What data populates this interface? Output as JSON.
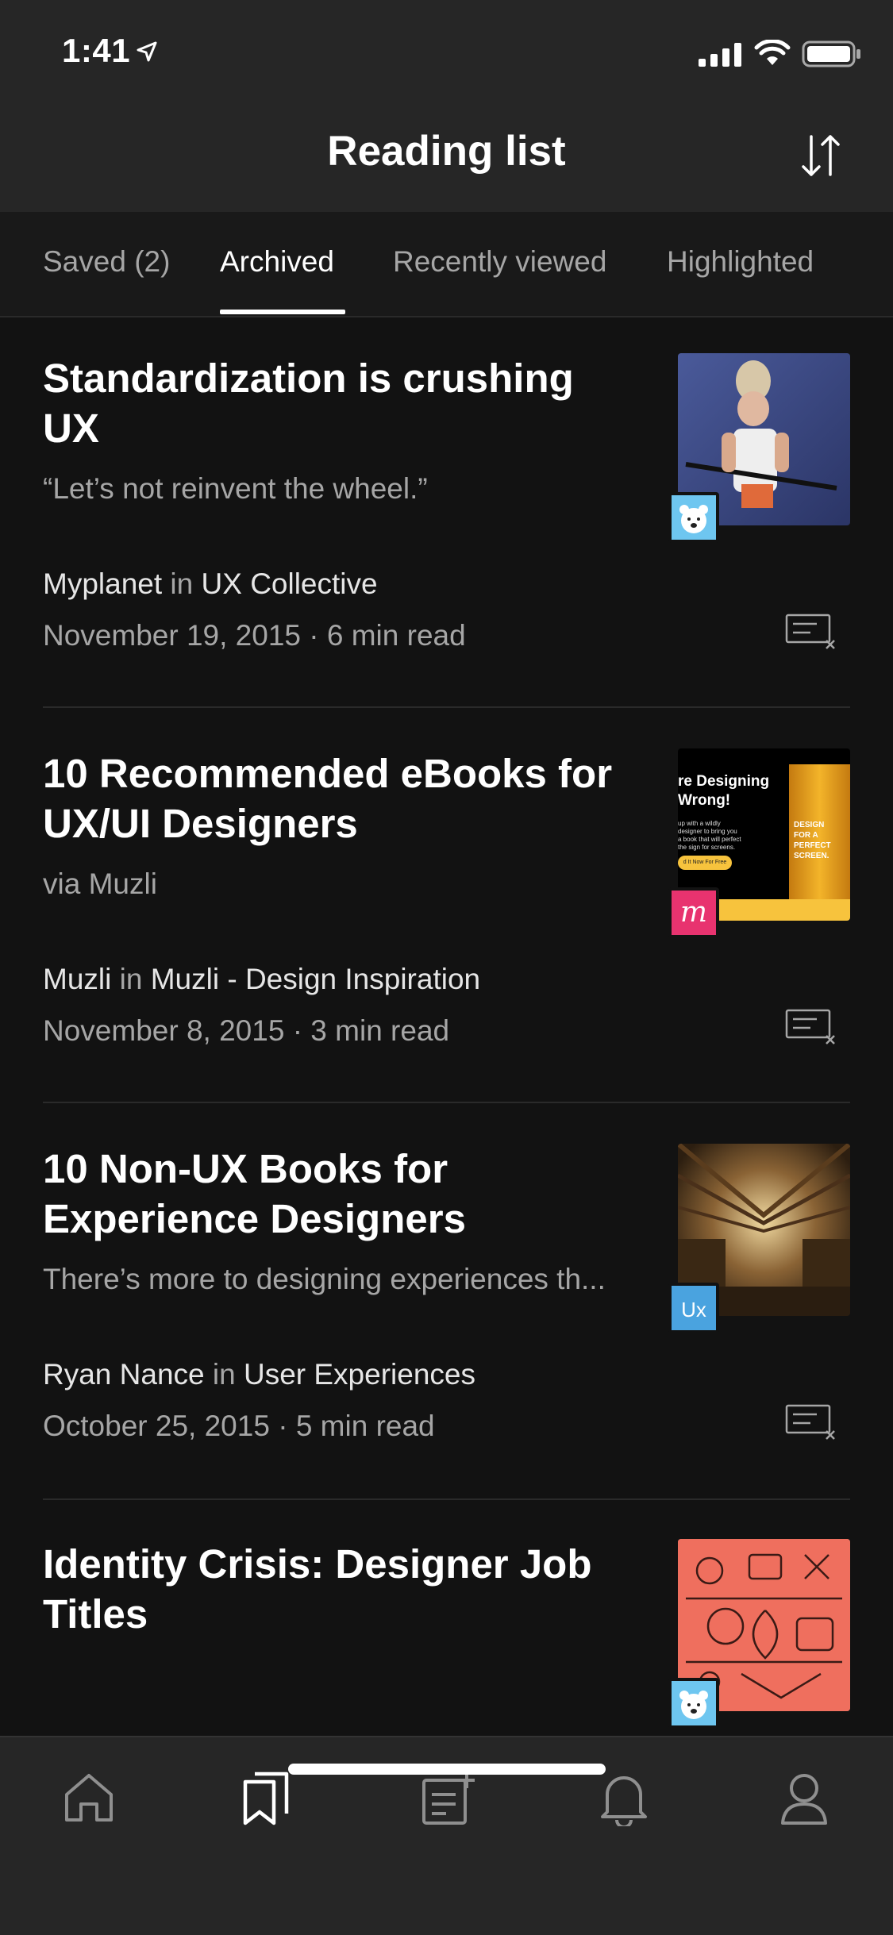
{
  "status_bar": {
    "time": "1:41"
  },
  "header": {
    "title": "Reading list"
  },
  "tabs": [
    {
      "label": "Saved (2)"
    },
    {
      "label": "Archived"
    },
    {
      "label": "Recently viewed"
    },
    {
      "label": "Highlighted"
    }
  ],
  "active_tab": "Archived",
  "articles": [
    {
      "title": "Standardization is crushing UX",
      "subtitle": "“Let’s not reinvent the wheel.”",
      "author": "Myplanet",
      "in": "in",
      "publication": "UX Collective",
      "date": "November 19, 2015",
      "sep": "·",
      "read_time": "6 min read"
    },
    {
      "title": "10 Recommended eBooks for UX/UI Designers",
      "subtitle": "via Muzli",
      "author": "Muzli",
      "in": "in",
      "publication": "Muzli - Design Inspiration",
      "date": "November 8, 2015",
      "sep": "·",
      "read_time": "3 min read",
      "thumb_text": {
        "headline": "re Designing Wrong!",
        "body": "up with a wildly designer to bring you a book that will perfect the sign for screens.",
        "button": "d It Now For Free",
        "cover": "DESIGN FOR A PERFECT SCREEN."
      },
      "badge_letter": "m"
    },
    {
      "title": "10 Non-UX Books for Experience Designers",
      "subtitle": "There’s more to designing experiences th...",
      "author": "Ryan Nance",
      "in": "in",
      "publication": "User Experiences",
      "date": "October 25, 2015",
      "sep": "·",
      "read_time": "5 min read",
      "badge_text": "Ux"
    },
    {
      "title": "Identity Crisis: Designer Job Titles"
    }
  ],
  "colors": {
    "background": "#121212",
    "header_bg": "#262626",
    "tabs_bg": "#191919",
    "muted_text": "#a6a6a6",
    "muzli_pink": "#e8336f",
    "ux_blue": "#4aa3df",
    "bear_blue": "#6ec6f0",
    "coral": "#ef6f5e"
  },
  "bottom_nav": [
    {
      "icon": "home-icon"
    },
    {
      "icon": "bookmarks-icon"
    },
    {
      "icon": "new-story-icon"
    },
    {
      "icon": "bell-icon"
    },
    {
      "icon": "profile-icon"
    }
  ]
}
